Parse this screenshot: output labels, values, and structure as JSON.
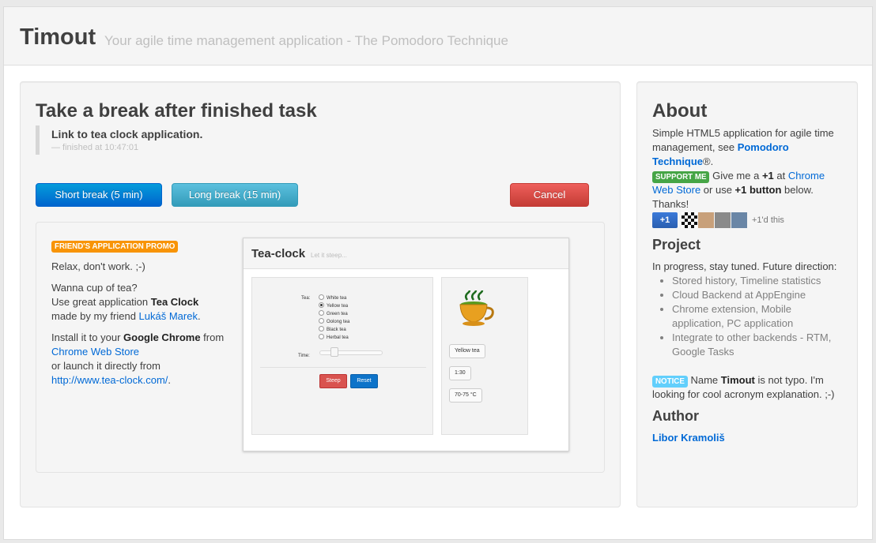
{
  "header": {
    "brand": "Timout",
    "tagline": "Your agile time management application - The Pomodoro Technique"
  },
  "task": {
    "title": "Take a break after finished task",
    "name": "Link to tea clock application.",
    "finished": "— finished at 10:47:01"
  },
  "buttons": {
    "short_break": "Short break (5 min)",
    "long_break": "Long break (15 min)",
    "cancel": "Cancel"
  },
  "promo": {
    "badge": "FRIEND'S APPLICATION PROMO",
    "line1": "Relax, don't work. ;-)",
    "p2_a": "Wanna cup of tea?",
    "p2_b": "Use great application ",
    "p2_bold": "Tea Clock",
    "p2_c": "made by my friend ",
    "p2_link": "Lukáš Marek",
    "p2_end": ".",
    "p3_a": "Install it to your ",
    "p3_bold": "Google Chrome",
    "p3_b": " from",
    "p3_link1": "Chrome Web Store",
    "p3_c": "or launch it directly from",
    "p3_link2": "http://www.tea-clock.com/",
    "p3_end": "."
  },
  "teaclock": {
    "title": "Tea-clock",
    "subtitle": "Let it steep...",
    "tea_label": "Tea:",
    "teas": [
      "White tea",
      "Yellow tea",
      "Green tea",
      "Oolong tea",
      "Black tea",
      "Herbal tea"
    ],
    "selected_index": 1,
    "time_label": "Time:",
    "slider_fraction": 0.2,
    "steep_label": "Steep",
    "reset_label": "Reset",
    "chip_tea": "Yellow tea",
    "chip_time": "1:30",
    "chip_temp": "70-75 °C"
  },
  "about": {
    "heading": "About",
    "t1": "Simple HTML5 application for agile time management, see ",
    "pomodoro_link": "Pomodoro Technique",
    "t1_end": "®.",
    "support_badge": "SUPPORT ME",
    "t2": " Give me a ",
    "t2_bold": "+1",
    "t2_b": " at ",
    "store_link": "Chrome Web Store",
    "t2_c": " or use ",
    "t2_bold2": "+1 button",
    "t2_d": " below.",
    "thanks": "Thanks!",
    "plusone_button": "+1",
    "plusone_text": "+1'd this"
  },
  "project": {
    "heading": "Project",
    "intro": "In progress, stay tuned. Future direction:",
    "items": [
      "Stored history, Timeline statistics",
      "Cloud Backend at AppEngine",
      "Chrome extension, Mobile application, PC application",
      "Integrate to other backends - RTM, Google Tasks"
    ]
  },
  "notice": {
    "badge": "NOTICE",
    "t1": " Name ",
    "bold": "Timout",
    "t2": " is not typo. I'm looking for cool acronym explanation. ;-)"
  },
  "author": {
    "heading": "Author",
    "name": "Libor Kramoliš"
  },
  "colors": {
    "primary": "#0064cd",
    "info": "#339bb9",
    "danger": "#c43c35",
    "link": "#0069d6"
  }
}
